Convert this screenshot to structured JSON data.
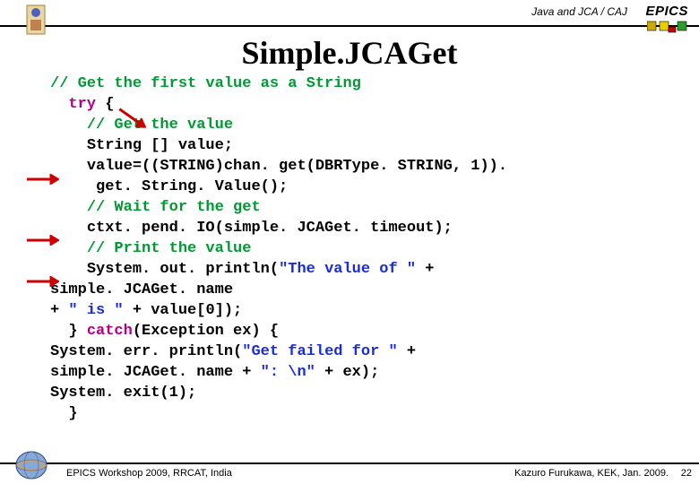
{
  "header": {
    "breadcrumb": "Java and JCA / CAJ",
    "epics_label": "EPICS"
  },
  "title": "Simple.JCAGet",
  "code": {
    "line1_comment": "// Get the first value as a String",
    "line2_kw": "try",
    "line2_rest": " {",
    "line3_comment": "// Get the value",
    "line4": "String [] value;",
    "line5": "value=((STRING)chan. get(DBRType. STRING, 1)).",
    "line6": " get. String. Value();",
    "line7_comment": "// Wait for the get",
    "line8": "ctxt. pend. IO(simple. JCAGet. timeout);",
    "line9_comment": "// Print the value",
    "line10a": "System. out. println(",
    "line10_str": "\"The value of \"",
    "line10b": " +",
    "line11": "simple. JCAGet. name",
    "line12a": "    + ",
    "line12_str": "\" is \"",
    "line12b": " + value[0]);",
    "line13a": "} ",
    "line13_kw": "catch",
    "line13b": "(Exception ex) {",
    "line14a": "    System. err. println(",
    "line14_str": "\"Get failed for \"",
    "line14b": " +",
    "line15a": "      simple. JCAGet. name + ",
    "line15_str": "\": \\n\"",
    "line15b": " + ex);",
    "line16": "    System. exit(1);",
    "line17": "}"
  },
  "footer": {
    "left": "EPICS Workshop 2009, RRCAT, India",
    "right": "Kazuro Furukawa, KEK, Jan. 2009.",
    "page": "22"
  }
}
